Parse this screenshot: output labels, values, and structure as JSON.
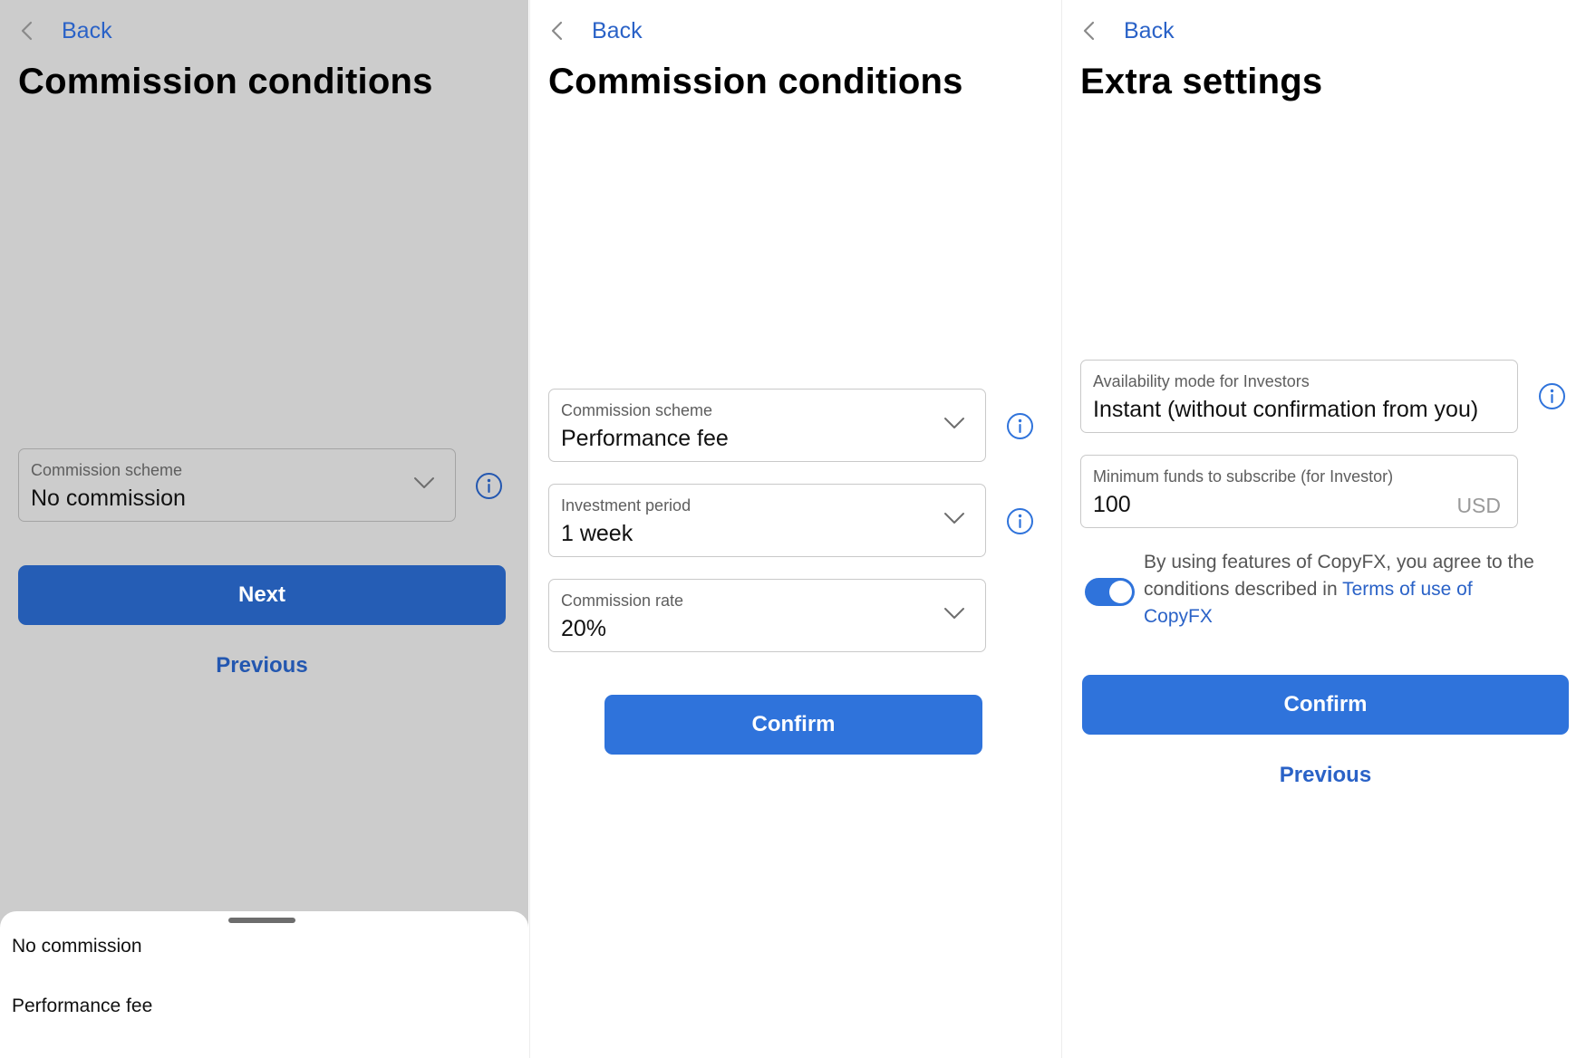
{
  "panel1": {
    "back_label": "Back",
    "title": "Commission conditions",
    "scheme_field": {
      "label": "Commission scheme",
      "value": "No commission"
    },
    "next_label": "Next",
    "previous_label": "Previous",
    "sheet_options": [
      "No commission",
      "Performance fee"
    ]
  },
  "panel2": {
    "back_label": "Back",
    "title": "Commission conditions",
    "scheme_field": {
      "label": "Commission scheme",
      "value": "Performance fee"
    },
    "period_field": {
      "label": "Investment period",
      "value": "1 week"
    },
    "rate_field": {
      "label": "Commission rate",
      "value": "20%"
    },
    "confirm_label": "Confirm"
  },
  "panel3": {
    "back_label": "Back",
    "title": "Extra settings",
    "availability_field": {
      "label": "Availability mode for Investors",
      "value": "Instant (without confirmation from you)"
    },
    "min_funds_field": {
      "label": "Minimum funds to subscribe (for Investor)",
      "value": "100",
      "unit": "USD"
    },
    "agreement_text": "By using features of CopyFX, you agree to the conditions described in ",
    "terms_link": "Terms of use of CopyFX",
    "toggle_state": "on",
    "confirm_label": "Confirm",
    "previous_label": "Previous"
  },
  "icons": {
    "back": "chevron-left-icon",
    "dropdown": "chevron-down-icon",
    "info": "info-circle-icon"
  },
  "colors": {
    "accent": "#2f73db",
    "link": "#2a62c7",
    "overlay_gray": "#cccccc"
  }
}
